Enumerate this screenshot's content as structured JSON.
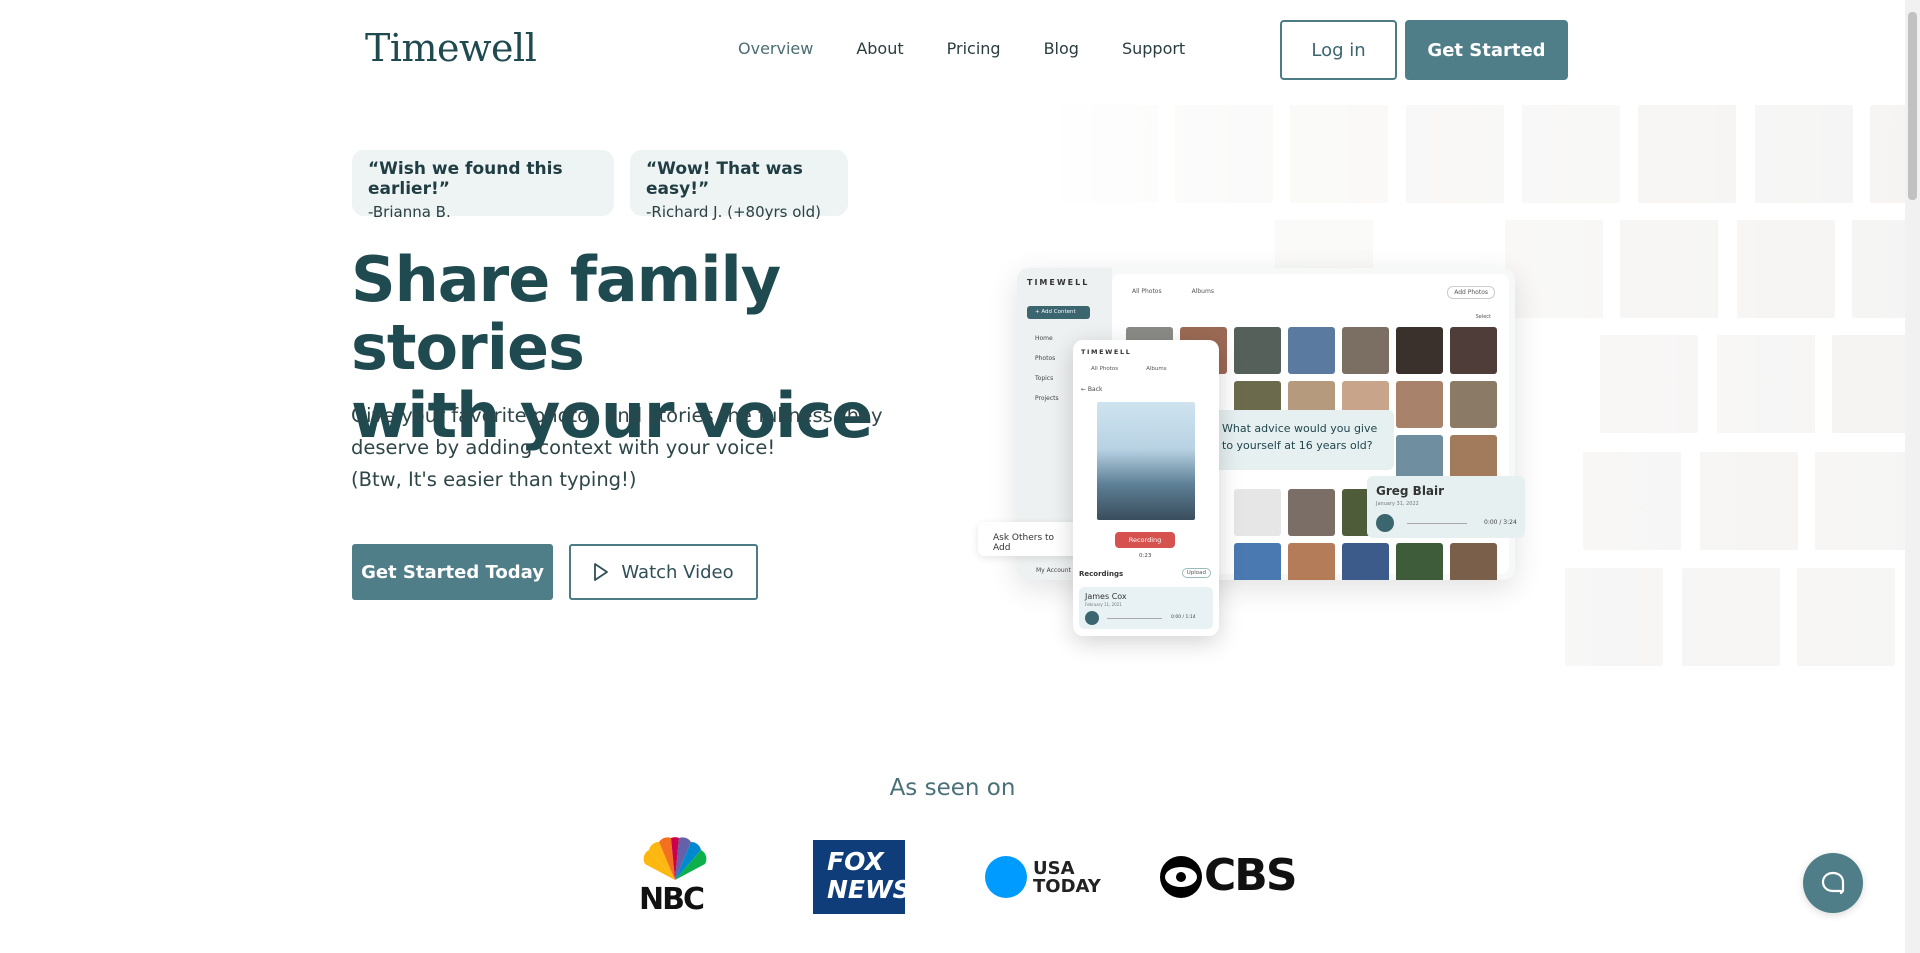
{
  "nav": {
    "logo": "Timewell",
    "links": [
      "Overview",
      "About",
      "Pricing",
      "Blog",
      "Support"
    ],
    "login": "Log in",
    "get_started": "Get Started"
  },
  "quotes": [
    {
      "text": "“Wish we found this earlier!”",
      "author": "-Brianna B."
    },
    {
      "text": "“Wow! That was easy!”",
      "author": "-Richard J. (+80yrs old)"
    }
  ],
  "hero": {
    "headline_line1": "Share family stories",
    "headline_line2": "with your voice",
    "sub_line1": "Give your favorite photos and stories the fullness they",
    "sub_line2": "deserve by adding context with your voice!",
    "sub_line3": "(Btw, It's easier than typing!)",
    "cta_primary": "Get Started Today",
    "cta_secondary": "Watch Video"
  },
  "mockup": {
    "app_logo": "TIMEWELL",
    "add_content": "+ Add Content",
    "menu": [
      "Home",
      "Photos",
      "Topics",
      "Projects"
    ],
    "tabs": [
      "All Photos",
      "Albums"
    ],
    "add_photos": "Add Photos",
    "select": "Select",
    "question": "What advice would you give to yourself at 16 years old?",
    "ask_others": "Ask Others to Add",
    "my_account": "My Account",
    "phone": {
      "logo": "TIMEWELL",
      "tabs": [
        "All Photos",
        "Albums"
      ],
      "back": "← Back",
      "recording": "Recording",
      "time": "0:23",
      "recordings_label": "Recordings",
      "upload": "Upload",
      "card_name": "James Cox",
      "card_date": "February 11, 2021",
      "card_time": "0:00 / 1:14"
    },
    "audio": {
      "name": "Greg Blair",
      "date": "January 31, 2022",
      "time": "0:00 / 3:24"
    }
  },
  "seen_on": {
    "title": "As seen on",
    "nbc": "NBC",
    "fox": "FOX NEWS",
    "usa": "USA TODAY",
    "cbs": "CBS"
  },
  "colors": {
    "primary": "#4f7d88",
    "heading": "#1f4a50",
    "quote_bg": "#eef3f3",
    "usa_blue": "#009bff",
    "fox_blue": "#0e3d7a"
  }
}
